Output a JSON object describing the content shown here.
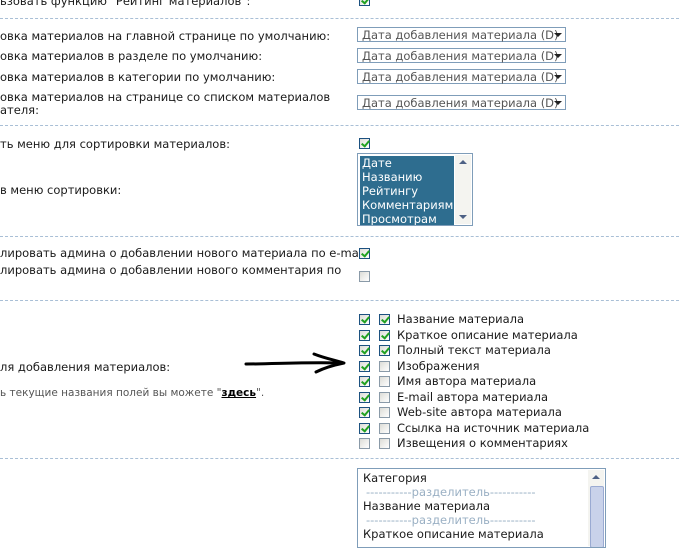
{
  "rows": {
    "rating_label": "ьзовать функцию \"Рейтинг материалов\":",
    "sort_main_label": "овка материалов на главной странице по умолчанию:",
    "sort_section_label": "овка материалов в разделе по умолчанию:",
    "sort_category_label": "овка материалов в категории по умолчанию:",
    "sort_list_label_1": "овка материалов на странице со списком материалов",
    "sort_list_label_2": "ателя:",
    "sort_menu_enable_label": "ть меню для сортировки материалов:",
    "sort_menu_fields_label": "в меню сортировки:",
    "notify_material_label": "лировать админа о добавлении нового материала по e-mail:",
    "notify_comment_label": "лировать админа о добавлении нового комментария по",
    "add_fields_label": "ля добавления материалов:",
    "hint_text": "ь текущие названия полей вы можете \"",
    "hint_link": "здесь",
    "hint_end": "\"."
  },
  "select_value": "Дата добавления материала (D)",
  "sort_menu_options": [
    "Дате",
    "Названию",
    "Рейтингу",
    "Комментариям",
    "Просмотрам"
  ],
  "fields": [
    {
      "label": "Название материала",
      "outer": true,
      "inner": true
    },
    {
      "label": "Краткое описание материала",
      "outer": true,
      "inner": true
    },
    {
      "label": "Полный текст материала",
      "outer": true,
      "inner": true
    },
    {
      "label": "Изображения",
      "outer": true,
      "inner": false
    },
    {
      "label": "Имя автора материала",
      "outer": true,
      "inner": false
    },
    {
      "label": "E-mail автора материала",
      "outer": true,
      "inner": false
    },
    {
      "label": "Web-site автора материала",
      "outer": true,
      "inner": false
    },
    {
      "label": "Ссылка на источник материала",
      "outer": true,
      "inner": false
    },
    {
      "label": "Извещения о комментариях",
      "outer": false,
      "inner": false
    }
  ],
  "order_list": [
    "Категория",
    "-----------разделитель-----------",
    "Название материала",
    "-----------разделитель-----------",
    "Краткое описание материала"
  ]
}
